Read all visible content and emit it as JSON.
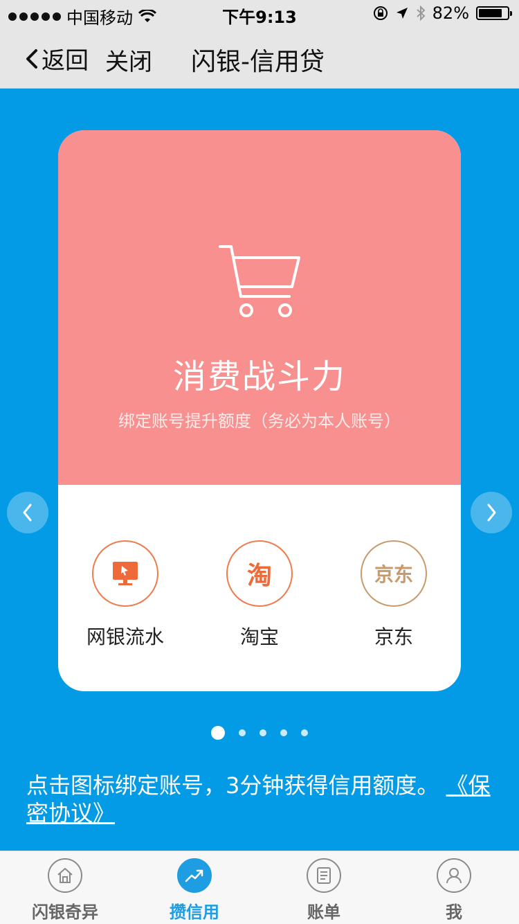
{
  "status_bar": {
    "carrier": "中国移动",
    "time": "下午9:13",
    "battery": "82%",
    "battery_level": 0.82
  },
  "nav": {
    "back_label": "返回",
    "close_label": "关闭",
    "title": "闪银-信用贷"
  },
  "card": {
    "title": "消费战斗力",
    "subtitle": "绑定账号提升额度（务必为本人账号）",
    "options": [
      {
        "label": "网银流水",
        "icon": "monitor-icon"
      },
      {
        "label": "淘宝",
        "icon": "taobao-logo",
        "icon_text": "淘"
      },
      {
        "label": "京东",
        "icon": "jd-logo",
        "icon_text": "京东"
      }
    ]
  },
  "pager": {
    "count": 5,
    "active_index": 0
  },
  "note": {
    "text": "点击图标绑定账号，3分钟获得信用额度。",
    "link": "《保密协议》"
  },
  "tabbar": {
    "items": [
      {
        "label": "闪银奇异",
        "icon": "home-icon",
        "active": false
      },
      {
        "label": "攒信用",
        "icon": "trend-up-icon",
        "active": true
      },
      {
        "label": "账单",
        "icon": "bill-icon",
        "active": false
      },
      {
        "label": "我",
        "icon": "user-icon",
        "active": false
      }
    ]
  },
  "colors": {
    "background": "#039be5",
    "card_top": "#f99090",
    "accent": "#1f9de2",
    "option_border": "#ef7b4d"
  }
}
